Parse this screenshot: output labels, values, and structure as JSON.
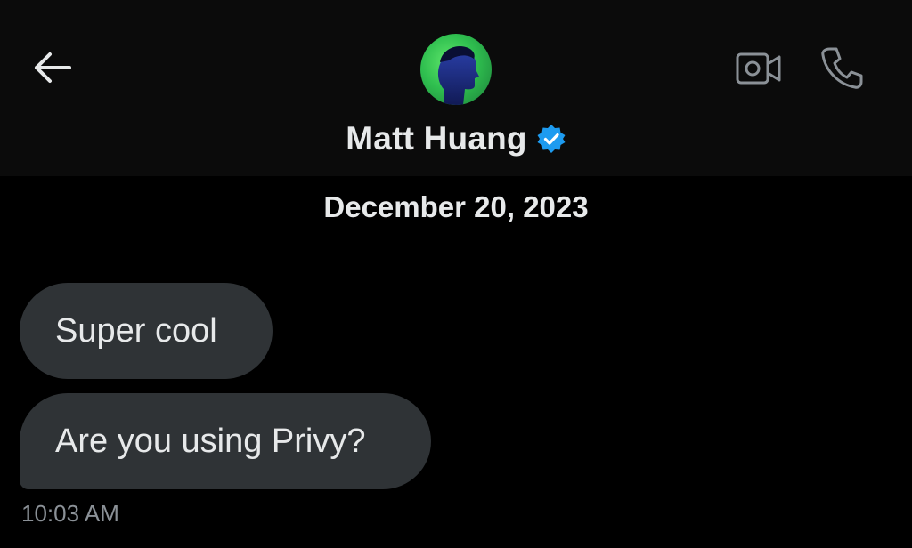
{
  "header": {
    "back_icon": "arrow-left-icon",
    "contact_name": "Matt Huang",
    "verified_icon": "verified-badge-icon",
    "video_call_icon": "video-camera-icon",
    "phone_call_icon": "phone-icon",
    "verified_color": "#1d9bf0",
    "avatar_color": "#2fbf4f"
  },
  "conversation": {
    "date": "December 20, 2023",
    "messages": [
      {
        "text": "Super cool"
      },
      {
        "text": "Are you using Privy?"
      }
    ],
    "timestamp": "10:03 AM"
  },
  "colors": {
    "background": "#000000",
    "header_background": "#0b0b0b",
    "bubble": "#2f3336",
    "text_primary": "#e7e9ea",
    "text_secondary": "#8b9197"
  }
}
